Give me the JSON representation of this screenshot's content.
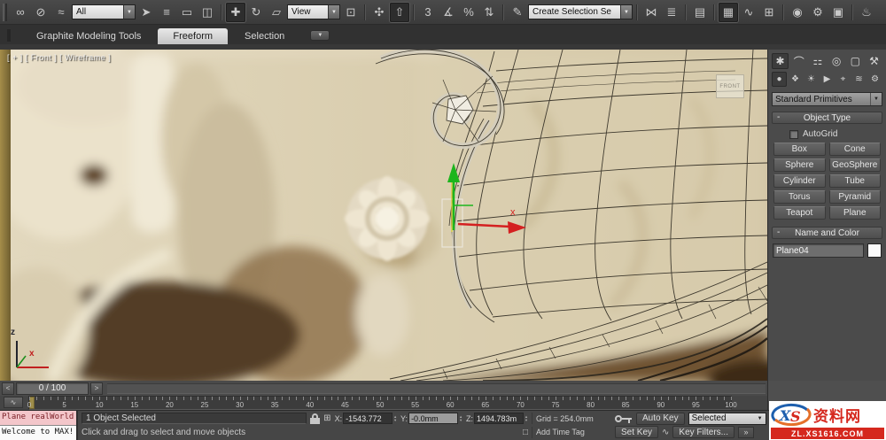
{
  "icons": {
    "dropdown_arrow": "▼",
    "select_and_link": "∞",
    "unlink": "⊘",
    "bind_space_warp": "≈",
    "select_object": "➤",
    "select_by_name": "≡",
    "rect_region": "▭",
    "window_crossing": "◫",
    "select_move": "✚",
    "select_rotate": "↻",
    "select_scale": "▱",
    "use_pivot": "⊡",
    "select_manipulate": "✣",
    "kbd_override": "⇧",
    "snap3": "3",
    "angle_snap": "∡",
    "percent_snap": "%",
    "spinner_snap": "⇅",
    "named_sets": "✎",
    "mirror": "⋈",
    "align": "≣",
    "layer_manager": "▤",
    "ribbon_toggle": "▦",
    "curve_editor": "∿",
    "schematic_view": "⊞",
    "material_editor": "◉",
    "render_setup": "⚙",
    "rendered_frame": "▣",
    "render_production": "♨",
    "ribbon_min": "▼",
    "create_tab": "✱",
    "modify_tab": "⌒",
    "hierarchy_tab": "⚏",
    "motion_tab": "◎",
    "display_tab": "▢",
    "utilities_tab": "⚒",
    "geometry_cat": "●",
    "shapes_cat": "❖",
    "lights_cat": "☀",
    "cameras_cat": "▶",
    "helpers_cat": "⌖",
    "spacewarps_cat": "≋",
    "systems_cat": "⚙",
    "abs_mode": "⊞",
    "isolate": "□",
    "mini_curve": "∿",
    "prev_key": "«",
    "next_key": "»",
    "slider_prev": "<",
    "slider_next": ">"
  },
  "toolbar": {
    "filter_value": "All",
    "coord_value": "View",
    "selection_set_value": "Create Selection Se"
  },
  "ribbon": {
    "tab1": "Graphite Modeling Tools",
    "tab2": "Freeform",
    "tab3": "Selection"
  },
  "viewport": {
    "label": "[ + ] [ Front ] [ Wireframe ]",
    "viewcube": "FRONT",
    "gizmo_axis_label": "x",
    "axis_x": "x",
    "axis_z": "z"
  },
  "command_panel": {
    "category_dropdown": "Standard Primitives",
    "object_type": {
      "collapse": "-",
      "title": "Object Type",
      "autogrid": "AutoGrid",
      "buttons": [
        "Box",
        "Cone",
        "Sphere",
        "GeoSphere",
        "Cylinder",
        "Tube",
        "Torus",
        "Pyramid",
        "Teapot",
        "Plane"
      ]
    },
    "name_color": {
      "collapse": "-",
      "title": "Name and Color",
      "name_value": "Plane04"
    }
  },
  "timeline": {
    "time_display": "0 / 100",
    "tick_labels": [
      "0",
      "5",
      "10",
      "15",
      "20",
      "25",
      "30",
      "35",
      "40",
      "45",
      "50",
      "55",
      "60",
      "65",
      "70",
      "75",
      "80",
      "85",
      "90",
      "95",
      "100"
    ]
  },
  "status": {
    "listener_line1": "Plane realWorld",
    "listener_line2": "Welcome to MAX!",
    "selection_status": "1 Object Selected",
    "prompt": "Click and drag to select and move objects",
    "x_label": "X:",
    "x_value": "-1543.772",
    "y_label": "Y:",
    "y_value": "-0.0mm",
    "z_label": "Z:",
    "z_value": "1494.783m",
    "grid_label": "Grid = 254.0mm",
    "add_time_tag": "Add Time Tag",
    "auto_key": "Auto Key",
    "set_key": "Set Key",
    "key_mode": "Selected",
    "key_filters": "Key Filters..."
  },
  "watermark": {
    "logo": "XS",
    "name": "资料网",
    "url": "ZL.XS1616.COM"
  },
  "colors": {
    "gizmo_green": "#1db51d",
    "gizmo_red": "#d42020",
    "frame_marker_gold": "#9d8c49",
    "listener_pink": "#f3c6ca",
    "watermark_red": "#d5281e",
    "watermark_blue": "#1d5fae",
    "watermark_orange": "#e5702b",
    "panel_bg": "#4b4b4b",
    "toolbar_bg": "#3f3f3f"
  }
}
